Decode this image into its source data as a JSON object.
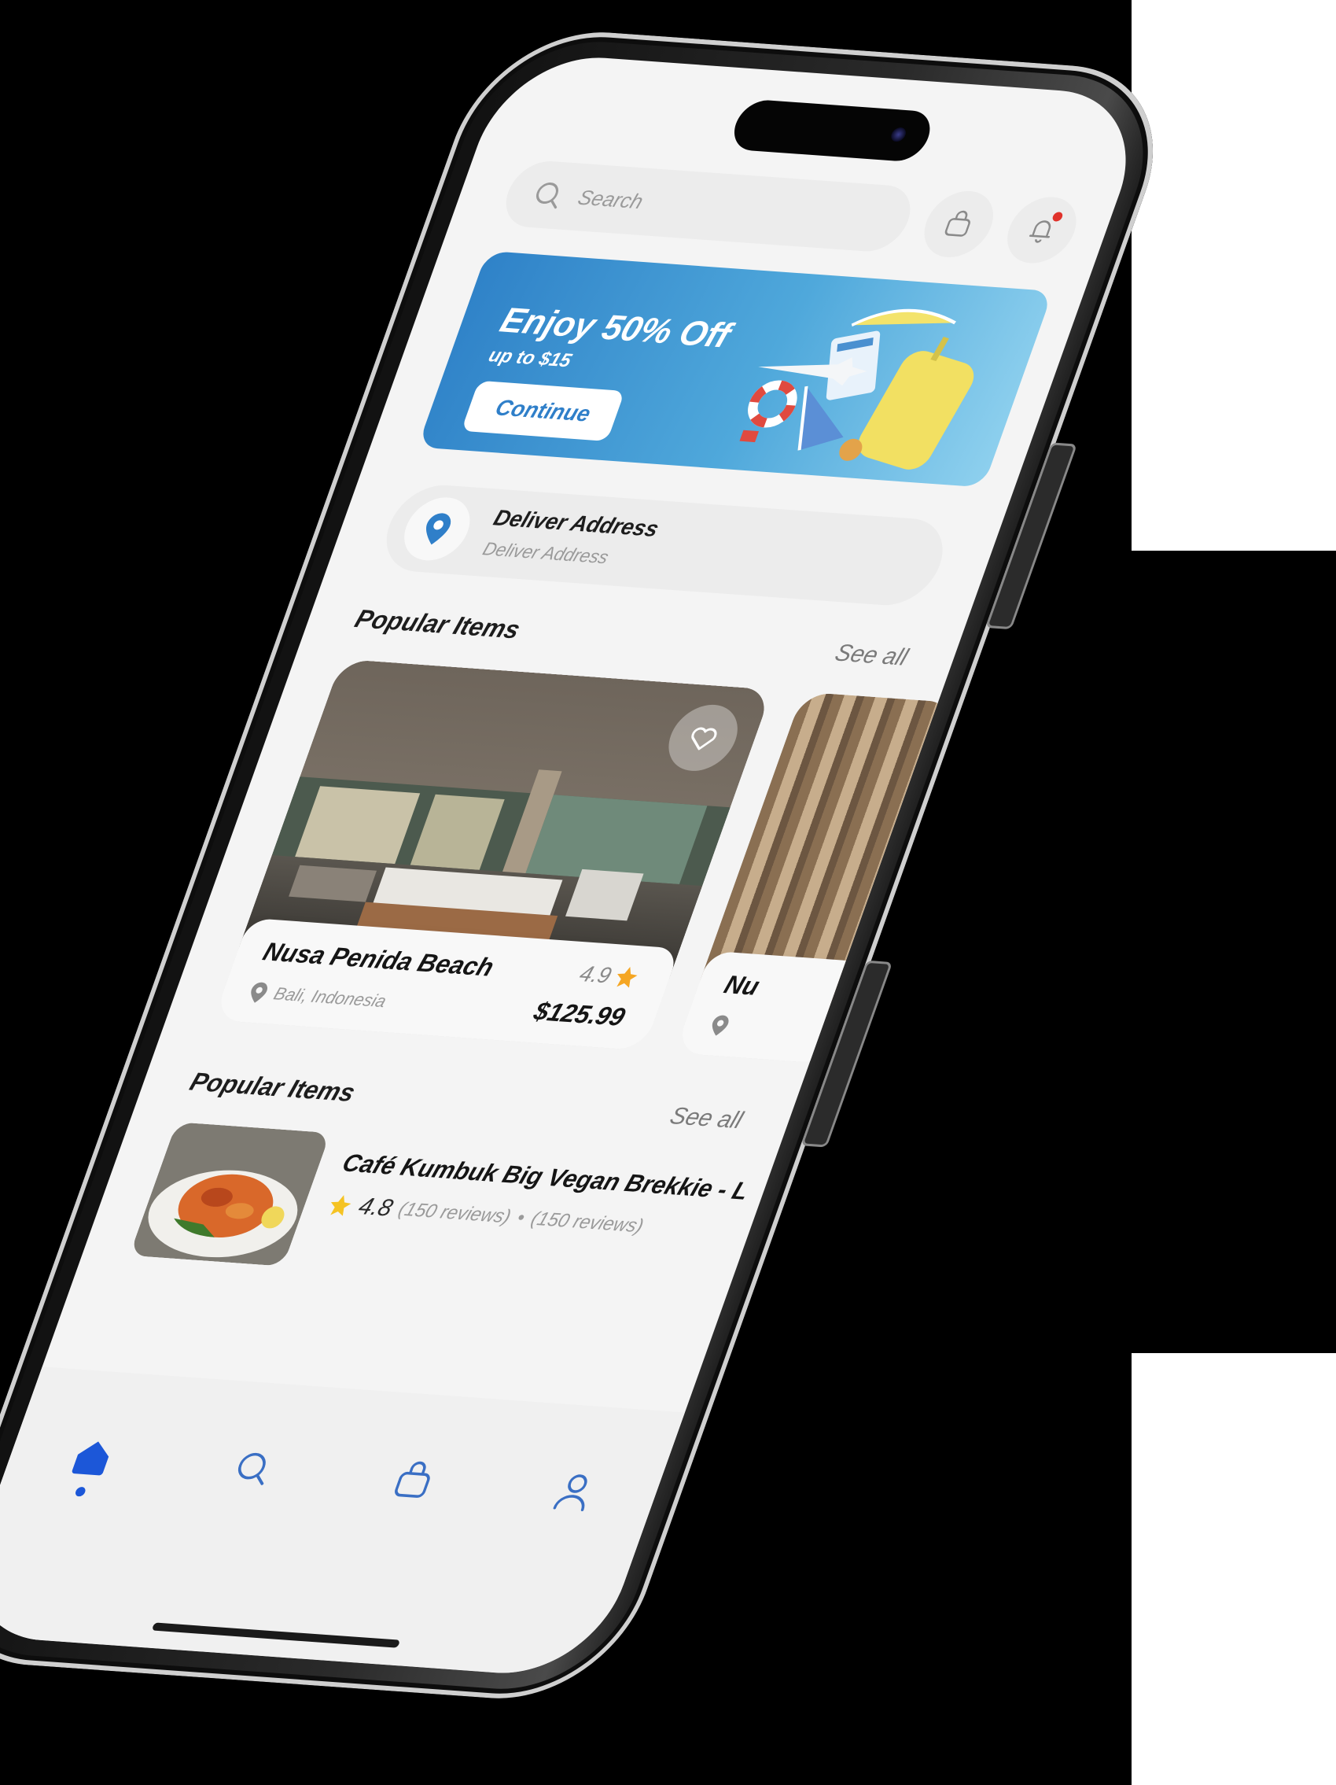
{
  "search": {
    "placeholder": "Search"
  },
  "banner": {
    "title": "Enjoy 50% Off",
    "subtitle": "up to $15",
    "button_label": "Continue"
  },
  "address": {
    "title": "Deliver Address",
    "subtitle": "Deliver Address"
  },
  "section_1": {
    "title": "Popular Items",
    "see_all": "See all"
  },
  "card_1": {
    "name": "Nusa Penida Beach",
    "rating": "4.9",
    "location": "Bali, Indonesia",
    "price": "$125.99"
  },
  "card_2": {
    "name_partial": "Nu"
  },
  "section_2": {
    "title": "Popular Items",
    "see_all": "See all"
  },
  "list_item": {
    "title": "Café Kumbuk Big Vegan Brekkie - L",
    "rating": "4.8",
    "reviews_a": "(150 reviews)",
    "separator": "•",
    "reviews_b": "(150 reviews)"
  },
  "nav": {
    "items": [
      "home-icon",
      "search-icon",
      "bag-icon",
      "profile-icon"
    ],
    "active_color": "#1c57d8",
    "inactive_color": "#3a6fc4"
  },
  "colors": {
    "accent": "#2f7fc9",
    "star": "#f5a623",
    "notification": "#e0322b"
  }
}
